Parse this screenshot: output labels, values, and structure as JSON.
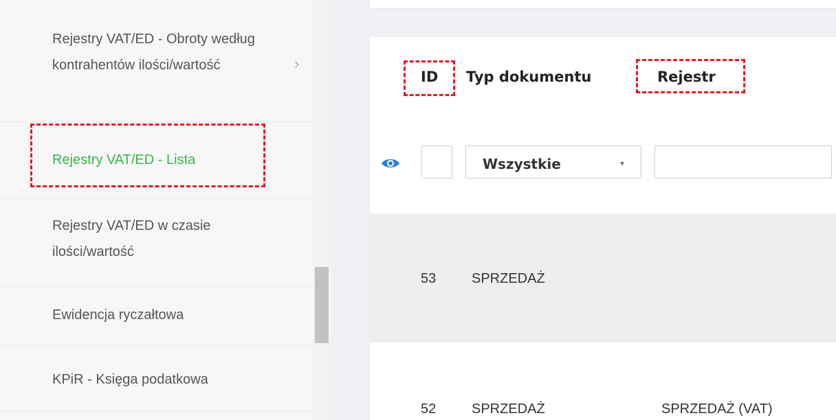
{
  "sidebar": {
    "items": [
      {
        "label": "Rejestry VAT/ED - Obroty według kontrahentów ilości/wartość",
        "has_submenu": true,
        "active": false
      },
      {
        "label": "Rejestry VAT/ED - Lista",
        "has_submenu": false,
        "active": true
      },
      {
        "label": "Rejestry VAT/ED w czasie ilości/wartość",
        "has_submenu": false,
        "active": false
      },
      {
        "label": "Ewidencja ryczałtowa",
        "has_submenu": false,
        "active": false
      },
      {
        "label": "KPiR - Księga podatkowa",
        "has_submenu": false,
        "active": false
      }
    ],
    "chevron_glyph": "›",
    "active_color": "#3cb44b"
  },
  "grid": {
    "columns": [
      "ID",
      "Typ dokumentu",
      "Rejestr"
    ],
    "filters": {
      "type_select_value": "Wszystkie",
      "caret_glyph": "▾",
      "register_input_value": ""
    },
    "rows": [
      {
        "id": "53",
        "type": "SPRZEDAŻ",
        "register": ""
      },
      {
        "id": "52",
        "type": "SPRZEDAŻ",
        "register": "SPRZEDAŻ (VAT)"
      }
    ]
  },
  "colors": {
    "highlight": "#e31b23",
    "eye_icon": "#2a7fd6",
    "selected_row": "#eeeeee"
  }
}
